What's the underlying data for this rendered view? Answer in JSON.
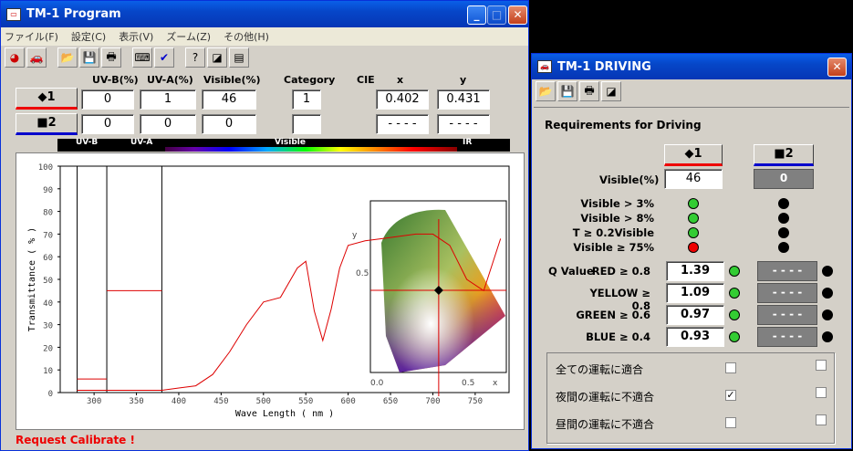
{
  "main": {
    "title": "TM-1 Program",
    "menu": [
      "ファイル(F)",
      "設定(C)",
      "表示(V)",
      "ズーム(Z)",
      "その他(H)"
    ],
    "headers": {
      "uvb": "UV-B(%)",
      "uva": "UV-A(%)",
      "visible": "Visible(%)",
      "category": "Category",
      "cie": "CIE",
      "x": "x",
      "y": "y"
    },
    "btn1": "◆1",
    "btn2": "■2",
    "row1": {
      "uvb": "0",
      "uva": "1",
      "visible": "46",
      "category": "1",
      "x": "0.402",
      "y": "0.431"
    },
    "row2": {
      "uvb": "0",
      "uva": "0",
      "visible": "0",
      "category": "",
      "x": "- - - -",
      "y": "- - - -"
    },
    "spectrum_labels": {
      "uvb": "UV-B",
      "uva": "UV-A",
      "visible": "Visible",
      "ir": "IR"
    },
    "status": "Request Calibrate !"
  },
  "chart_data": {
    "type": "line",
    "xlabel": "Wave Length ( nm )",
    "ylabel": "Transmittance ( % )",
    "xlim": [
      260,
      790
    ],
    "ylim": [
      0,
      100
    ],
    "x_ticks": [
      "300",
      "350",
      "400",
      "450",
      "500",
      "550",
      "600",
      "650",
      "700",
      "750"
    ],
    "y_ticks": [
      "0",
      "10",
      "20",
      "30",
      "40",
      "50",
      "60",
      "70",
      "80",
      "90",
      "100"
    ],
    "series": [
      {
        "x": [
          280,
          300,
          320,
          340,
          360,
          380,
          400,
          420,
          440,
          460,
          480,
          500,
          520,
          540,
          550,
          560,
          570,
          580,
          590,
          600,
          620,
          640,
          660,
          680,
          700,
          720,
          740,
          760,
          780
        ],
        "y": [
          1,
          1,
          1,
          1,
          1,
          1,
          2,
          3,
          8,
          18,
          30,
          40,
          42,
          55,
          58,
          36,
          23,
          37,
          55,
          65,
          67,
          68,
          69,
          70,
          70,
          65,
          50,
          45,
          68
        ]
      }
    ],
    "uvb_bar": 6,
    "uva_bar": 45,
    "cie_axis": {
      "x_ticks": [
        "0.0",
        "0.5",
        "x"
      ],
      "y_ticks": [
        "0.5",
        "y"
      ]
    },
    "cie_point": {
      "x": 0.402,
      "y": 0.431
    }
  },
  "driving": {
    "title": "TM-1 DRIVING",
    "heading": "Requirements for Driving",
    "btn1": "◆1",
    "btn2": "■2",
    "visible_label": "Visible(%)",
    "visible1": "46",
    "visible2": "0",
    "criteria": [
      "Visible > 3%",
      "Visible > 8%",
      "T ≥ 0.2Visible",
      "Visible ≥ 75%"
    ],
    "crit1": [
      "g",
      "g",
      "g",
      "r"
    ],
    "crit2": [
      "k",
      "k",
      "k",
      "k"
    ],
    "qvalue": "Q Value",
    "q": [
      {
        "label": "RED ≥ 0.8",
        "v1": "1.39",
        "v2": "- - - -"
      },
      {
        "label": "YELLOW ≥ 0.8",
        "v1": "1.09",
        "v2": "- - - -"
      },
      {
        "label": "GREEN ≥ 0.6",
        "v1": "0.97",
        "v2": "- - - -"
      },
      {
        "label": "BLUE ≥ 0.4",
        "v1": "0.93",
        "v2": "- - - -"
      }
    ],
    "checks": [
      {
        "label": "全ての運転に適合",
        "c1": "",
        "c2": ""
      },
      {
        "label": "夜間の運転に不適合",
        "c1": "✓",
        "c2": ""
      },
      {
        "label": "昼間の運転に不適合",
        "c1": "",
        "c2": ""
      }
    ]
  }
}
